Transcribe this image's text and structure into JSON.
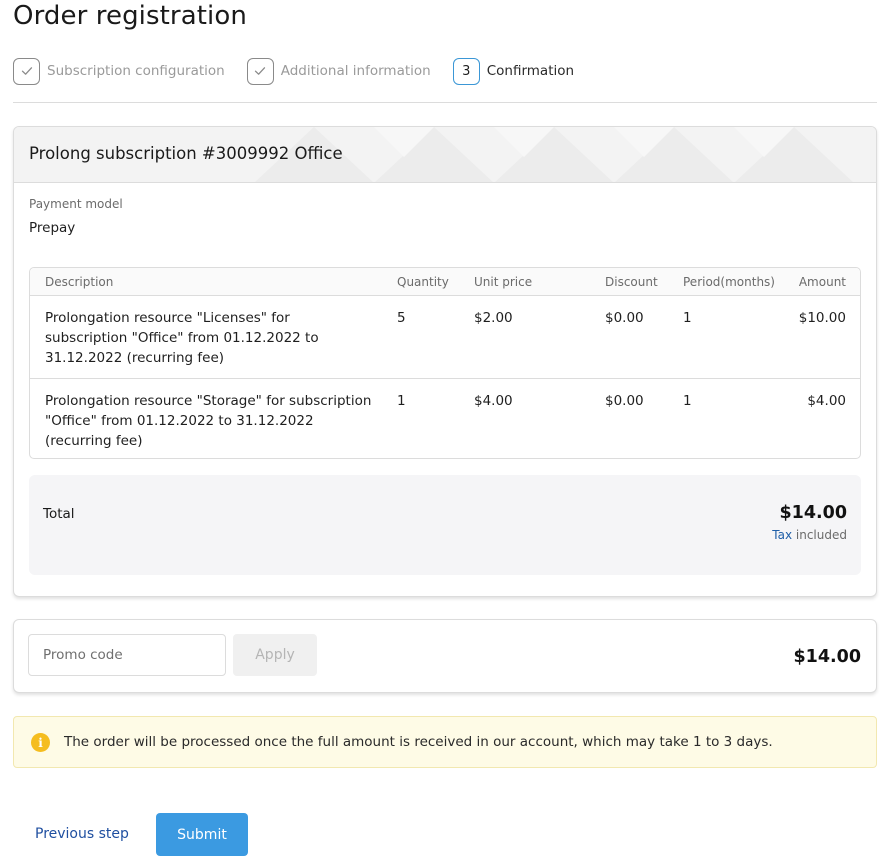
{
  "page": {
    "title": "Order registration"
  },
  "steps": [
    {
      "label": "Subscription configuration",
      "state": "done"
    },
    {
      "label": "Additional information",
      "state": "done"
    },
    {
      "number": "3",
      "label": "Confirmation",
      "state": "active"
    }
  ],
  "order": {
    "title": "Prolong subscription #3009992 Office",
    "payment_model_label": "Payment model",
    "payment_model_value": "Prepay",
    "table": {
      "headers": {
        "description": "Description",
        "quantity": "Quantity",
        "unit_price": "Unit price",
        "discount": "Discount",
        "period": "Period(months)",
        "amount": "Amount"
      },
      "rows": [
        {
          "description": "Prolongation resource \"Licenses\" for subscription \"Office\" from 01.12.2022 to 31.12.2022 (recurring fee)",
          "quantity": "5",
          "unit_price": "$2.00",
          "discount": "$0.00",
          "period": "1",
          "amount": "$10.00"
        },
        {
          "description": "Prolongation resource \"Storage\" for subscription \"Office\" from 01.12.2022 to 31.12.2022 (recurring fee)",
          "quantity": "1",
          "unit_price": "$4.00",
          "discount": "$0.00",
          "period": "1",
          "amount": "$4.00"
        }
      ]
    },
    "total_label": "Total",
    "total_amount": "$14.00",
    "tax_link": "Tax",
    "tax_suffix": " included"
  },
  "promo": {
    "placeholder": "Promo code",
    "value": "",
    "apply_label": "Apply",
    "total": "$14.00"
  },
  "notice": {
    "icon": "info-icon",
    "text": "The order will be processed once the full amount is received in our account, which may take 1 to 3 days."
  },
  "actions": {
    "previous_label": "Previous step",
    "submit_label": "Submit"
  },
  "colors": {
    "accent": "#3b9ae1",
    "link": "#1f4fa0",
    "notice_bg": "#fefbe6",
    "warning_icon": "#f5bd1f"
  }
}
